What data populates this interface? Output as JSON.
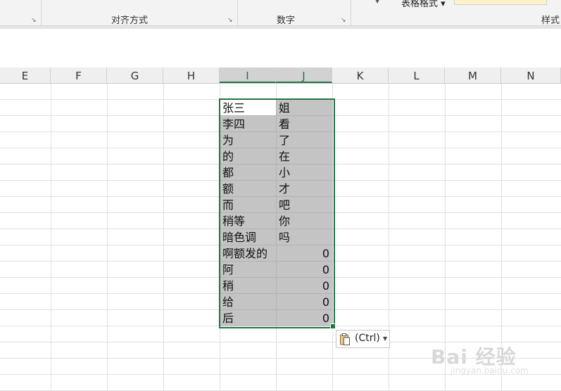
{
  "ribbon": {
    "groups": [
      {
        "label": "对齐方式"
      },
      {
        "label": "数字"
      }
    ],
    "table_format_label": "表格格式",
    "styles_label": "样式"
  },
  "columns": [
    "E",
    "F",
    "G",
    "H",
    "I",
    "J",
    "K",
    "L",
    "M",
    "N"
  ],
  "selected_columns": [
    "I",
    "J"
  ],
  "cells": {
    "column_i": [
      "张三",
      "李四",
      "为",
      "的",
      "都",
      "额",
      "而",
      "稍等",
      "暗色调",
      "啊额发的",
      "阿",
      "稍",
      "给",
      "后"
    ],
    "column_j": [
      "姐",
      "看",
      "了",
      "在",
      "小",
      "才",
      "吧",
      "你",
      "吗",
      "0",
      "0",
      "0",
      "0",
      "0"
    ]
  },
  "paste_options": {
    "label": "(Ctrl)"
  },
  "watermark": {
    "text": "Bai 经验",
    "sub": "jingyan.baidu.com"
  },
  "colors": {
    "accent": "#217346",
    "selection_fill": "#c4c4c4"
  }
}
